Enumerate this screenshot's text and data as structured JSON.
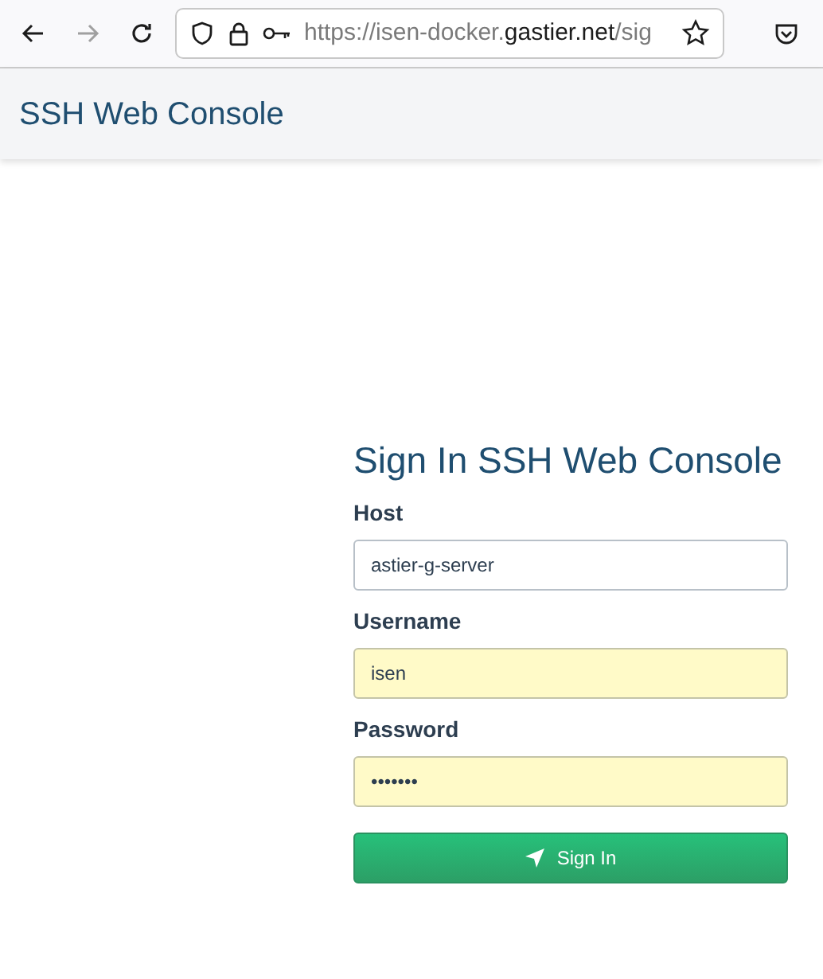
{
  "browser": {
    "back_enabled": true,
    "forward_enabled": false,
    "url": {
      "prefix": "https://isen-docker.",
      "domain": "gastier.net",
      "path": "/sig"
    }
  },
  "navbar": {
    "brand": "SSH Web Console"
  },
  "form": {
    "title": "Sign In SSH Web Console",
    "fields": [
      {
        "label": "Host",
        "value": "astier-g-server",
        "autofilled": false
      },
      {
        "label": "Username",
        "value": "isen",
        "autofilled": true
      },
      {
        "label": "Password",
        "value": "•••••••",
        "autofilled": true
      }
    ],
    "submit": "Sign In"
  }
}
